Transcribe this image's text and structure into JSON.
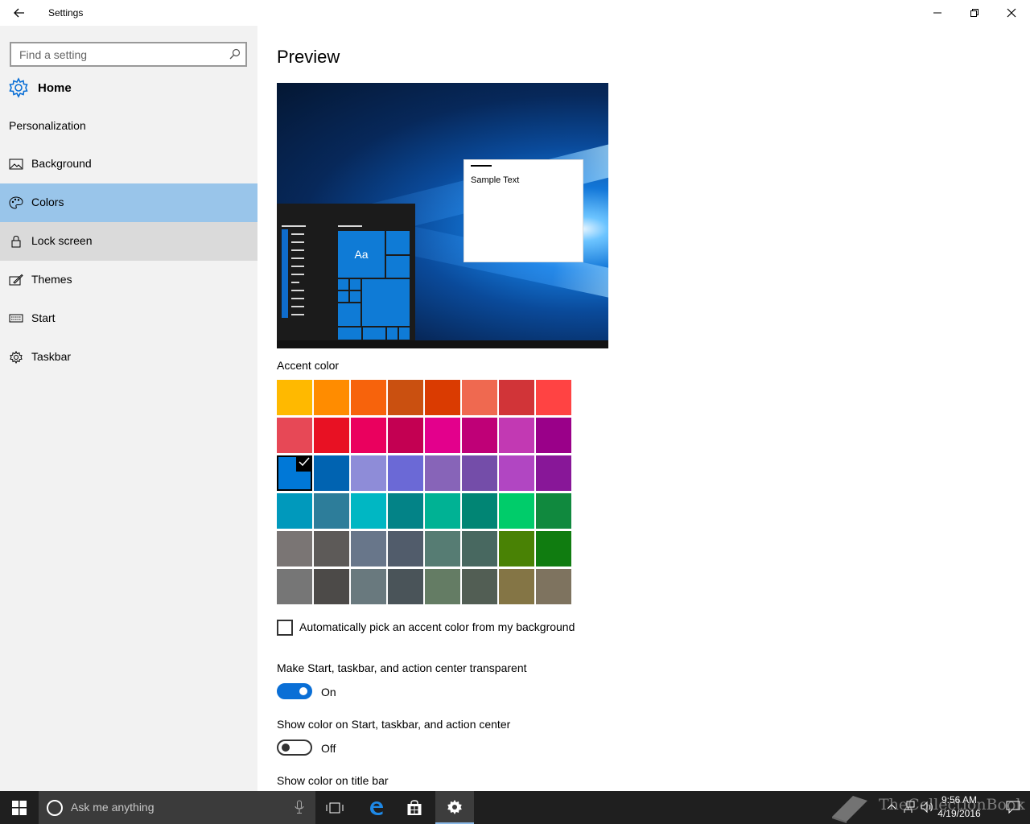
{
  "window": {
    "title": "Settings",
    "back_icon": "arrow-left-icon",
    "controls": [
      "minimize-icon",
      "restore-icon",
      "close-icon"
    ]
  },
  "sidebar": {
    "search_placeholder": "Find a setting",
    "home_label": "Home",
    "section_label": "Personalization",
    "items": [
      {
        "label": "Background",
        "icon": "picture-icon",
        "state": "normal"
      },
      {
        "label": "Colors",
        "icon": "palette-icon",
        "state": "selected"
      },
      {
        "label": "Lock screen",
        "icon": "lock-icon",
        "state": "hover"
      },
      {
        "label": "Themes",
        "icon": "brush-icon",
        "state": "normal"
      },
      {
        "label": "Start",
        "icon": "keyboard-icon",
        "state": "normal"
      },
      {
        "label": "Taskbar",
        "icon": "gear-icon",
        "state": "normal"
      }
    ]
  },
  "main": {
    "preview_heading": "Preview",
    "preview_tile_text": "Aa",
    "preview_window_text": "Sample Text",
    "accent_heading": "Accent color",
    "accent_colors": [
      [
        "#FFB900",
        "#FF8C00",
        "#F7630C",
        "#CA5010",
        "#DA3B01",
        "#EF6950",
        "#D13438",
        "#FF4343"
      ],
      [
        "#E74856",
        "#E81123",
        "#EA005E",
        "#C30052",
        "#E3008C",
        "#BF0077",
        "#C239B3",
        "#9A0089"
      ],
      [
        "#0078D7",
        "#0063B1",
        "#8E8CD8",
        "#6B69D6",
        "#8764B8",
        "#744DA9",
        "#B146C2",
        "#881798"
      ],
      [
        "#0099BC",
        "#2D7D9A",
        "#00B7C3",
        "#038387",
        "#00B294",
        "#018574",
        "#00CC6A",
        "#10893E"
      ],
      [
        "#7A7574",
        "#5D5A58",
        "#68768A",
        "#515C6B",
        "#567C73",
        "#486860",
        "#498205",
        "#107C10"
      ],
      [
        "#767676",
        "#4C4A48",
        "#69797E",
        "#4A5459",
        "#647C64",
        "#525E54",
        "#847545",
        "#7E735F"
      ]
    ],
    "selected_accent": "#0078D7",
    "auto_pick_label": "Automatically pick an accent color from my background",
    "auto_pick_checked": false,
    "transparent_label": "Make Start, taskbar, and action center transparent",
    "transparent_state": "On",
    "show_color_label": "Show color on Start, taskbar, and action center",
    "show_color_state": "Off",
    "title_bar_label": "Show color on title bar"
  },
  "taskbar": {
    "search_placeholder": "Ask me anything",
    "apps": [
      "task-view-icon",
      "edge-icon",
      "store-icon",
      "settings-icon"
    ],
    "time": "9:56 AM",
    "date": "4/19/2016",
    "watermark": "TheCollectionBook"
  },
  "colors": {
    "accent": "#0078D7",
    "selected_bg": "#99C5EA",
    "hover_bg": "#DADADA",
    "sidebar_bg": "#F2F2F2",
    "taskbar_bg": "#1F1F1F"
  }
}
